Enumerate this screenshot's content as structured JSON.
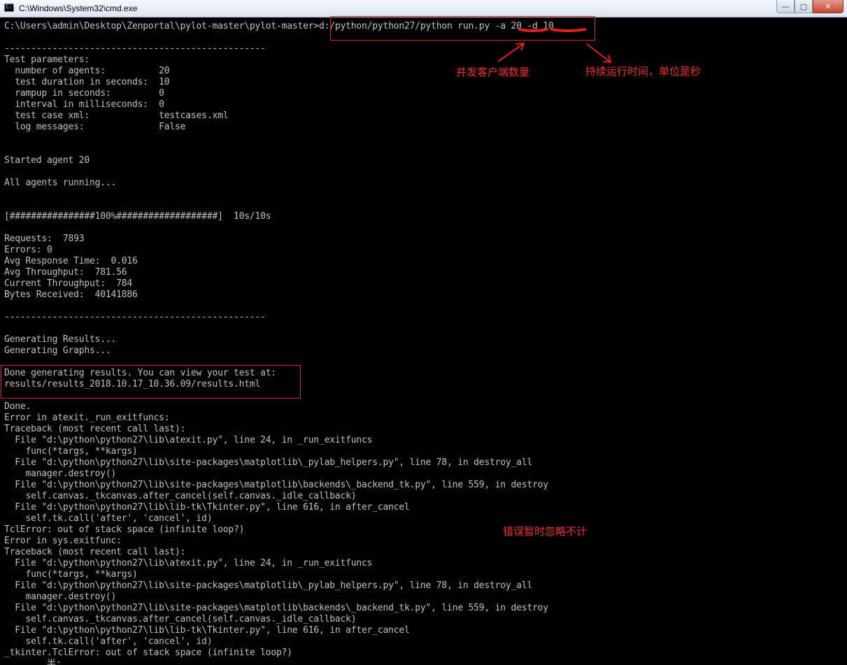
{
  "window": {
    "title": "C:\\Windows\\System32\\cmd.exe",
    "minimize_glyph": "—",
    "maximize_glyph": "▢",
    "close_glyph": "✕",
    "icon_glyph": "C:\\"
  },
  "console": {
    "lines": [
      "C:\\Users\\admin\\Desktop\\Zenportal\\pylot-master\\pylot-master>d:/python/python27/python run.py -a 20 -d 10",
      "",
      "-------------------------------------------------",
      "Test parameters:",
      "  number of agents:          20",
      "  test duration in seconds:  10",
      "  rampup in seconds:         0",
      "  interval in milliseconds:  0",
      "  test case xml:             testcases.xml",
      "  log messages:              False",
      "",
      "",
      "Started agent 20",
      "",
      "All agents running...",
      "",
      "",
      "[################100%###################]  10s/10s",
      "",
      "Requests:  7893",
      "Errors: 0",
      "Avg Response Time:  0.016",
      "Avg Throughput:  781.56",
      "Current Throughput:  784",
      "Bytes Received:  40141886",
      "",
      "-------------------------------------------------",
      "",
      "Generating Results...",
      "Generating Graphs...",
      "",
      "Done generating results. You can view your test at:",
      "results/results_2018.10.17_10.36.09/results.html",
      "",
      "Done.",
      "Error in atexit._run_exitfuncs:",
      "Traceback (most recent call last):",
      "  File \"d:\\python\\python27\\lib\\atexit.py\", line 24, in _run_exitfuncs",
      "    func(*targs, **kargs)",
      "  File \"d:\\python\\python27\\lib\\site-packages\\matplotlib\\_pylab_helpers.py\", line 78, in destroy_all",
      "    manager.destroy()",
      "  File \"d:\\python\\python27\\lib\\site-packages\\matplotlib\\backends\\_backend_tk.py\", line 559, in destroy",
      "    self.canvas._tkcanvas.after_cancel(self.canvas._idle_callback)",
      "  File \"d:\\python\\python27\\lib\\lib-tk\\Tkinter.py\", line 616, in after_cancel",
      "    self.tk.call('after', 'cancel', id)",
      "TclError: out of stack space (infinite loop?)",
      "Error in sys.exitfunc:",
      "Traceback (most recent call last):",
      "  File \"d:\\python\\python27\\lib\\atexit.py\", line 24, in _run_exitfuncs",
      "    func(*targs, **kargs)",
      "  File \"d:\\python\\python27\\lib\\site-packages\\matplotlib\\_pylab_helpers.py\", line 78, in destroy_all",
      "    manager.destroy()",
      "  File \"d:\\python\\python27\\lib\\site-packages\\matplotlib\\backends\\_backend_tk.py\", line 559, in destroy",
      "    self.canvas._tkcanvas.after_cancel(self.canvas._idle_callback)",
      "  File \"d:\\python\\python27\\lib\\lib-tk\\Tkinter.py\", line 616, in after_cancel",
      "    self.tk.call('after', 'cancel', id)",
      "_tkinter.TclError: out of stack space (infinite loop?)",
      "        半:"
    ]
  },
  "annotations": {
    "agents_note": "并发客户端数量",
    "duration_note": "持续运行时间，单位是秒",
    "error_note": "错误暂时忽略不计"
  },
  "colors": {
    "console_bg": "#000000",
    "console_text": "#c0c0c0",
    "annotation": "#ef2f2f"
  }
}
